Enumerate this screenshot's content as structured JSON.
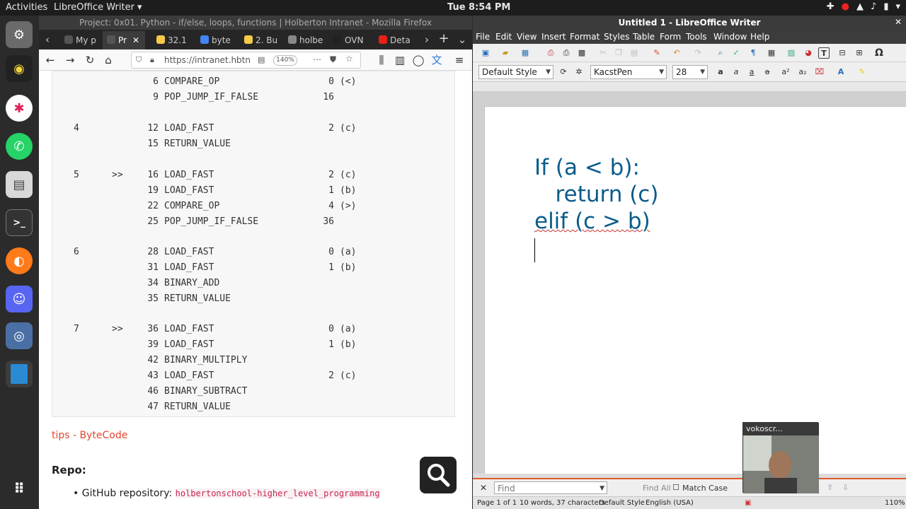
{
  "topbar": {
    "activities": "Activities",
    "app_menu": "LibreOffice Writer ▾",
    "clock": "Tue  8:54 PM",
    "tray": [
      "✚",
      "●",
      "▲",
      "♪",
      "▮",
      "▾"
    ]
  },
  "dock": {
    "items": [
      "settings",
      "radio",
      "slack",
      "whatsapp",
      "files",
      "terminal",
      "firefox",
      "discord",
      "screen-recorder",
      "libreoffice-impress",
      "app-grid"
    ]
  },
  "firefox": {
    "title": "Project: 0x01. Python - if/else, loops, functions | Holberton Intranet - Mozilla Firefox",
    "tabs": [
      {
        "label": "My p",
        "color": "#555"
      },
      {
        "label": "Pr",
        "color": "#555"
      },
      {
        "label": "32.1",
        "color": "#f7c948"
      },
      {
        "label": "byte",
        "color": "#4285f4"
      },
      {
        "label": "2. Bu",
        "color": "#f7c948"
      },
      {
        "label": "holbe",
        "color": "#888"
      },
      {
        "label": "OVN",
        "color": "#222"
      },
      {
        "label": "Deta",
        "color": "#e62117"
      }
    ],
    "url": "https://intranet.hbtn",
    "zoom": "140%",
    "bytecode": [
      {
        "line": "",
        "marker": "",
        "off": "6",
        "op": "COMPARE_OP",
        "arg": "0",
        "note": "(<)"
      },
      {
        "line": "",
        "marker": "",
        "off": "9",
        "op": "POP_JUMP_IF_FALSE",
        "arg": "16",
        "note": ""
      },
      {
        "line": "4",
        "marker": "",
        "off": "12",
        "op": "LOAD_FAST",
        "arg": "2",
        "note": "(c)"
      },
      {
        "line": "",
        "marker": "",
        "off": "15",
        "op": "RETURN_VALUE",
        "arg": "",
        "note": ""
      },
      {
        "line": "5",
        "marker": ">>",
        "off": "16",
        "op": "LOAD_FAST",
        "arg": "2",
        "note": "(c)"
      },
      {
        "line": "",
        "marker": "",
        "off": "19",
        "op": "LOAD_FAST",
        "arg": "1",
        "note": "(b)"
      },
      {
        "line": "",
        "marker": "",
        "off": "22",
        "op": "COMPARE_OP",
        "arg": "4",
        "note": "(>)"
      },
      {
        "line": "",
        "marker": "",
        "off": "25",
        "op": "POP_JUMP_IF_FALSE",
        "arg": "36",
        "note": ""
      },
      {
        "line": "6",
        "marker": "",
        "off": "28",
        "op": "LOAD_FAST",
        "arg": "0",
        "note": "(a)"
      },
      {
        "line": "",
        "marker": "",
        "off": "31",
        "op": "LOAD_FAST",
        "arg": "1",
        "note": "(b)"
      },
      {
        "line": "",
        "marker": "",
        "off": "34",
        "op": "BINARY_ADD",
        "arg": "",
        "note": ""
      },
      {
        "line": "",
        "marker": "",
        "off": "35",
        "op": "RETURN_VALUE",
        "arg": "",
        "note": ""
      },
      {
        "line": "7",
        "marker": ">>",
        "off": "36",
        "op": "LOAD_FAST",
        "arg": "0",
        "note": "(a)"
      },
      {
        "line": "",
        "marker": "",
        "off": "39",
        "op": "LOAD_FAST",
        "arg": "1",
        "note": "(b)"
      },
      {
        "line": "",
        "marker": "",
        "off": "42",
        "op": "BINARY_MULTIPLY",
        "arg": "",
        "note": ""
      },
      {
        "line": "",
        "marker": "",
        "off": "43",
        "op": "LOAD_FAST",
        "arg": "2",
        "note": "(c)"
      },
      {
        "line": "",
        "marker": "",
        "off": "46",
        "op": "BINARY_SUBTRACT",
        "arg": "",
        "note": ""
      },
      {
        "line": "",
        "marker": "",
        "off": "47",
        "op": "RETURN_VALUE",
        "arg": "",
        "note": ""
      }
    ],
    "tips_link": "tips - ByteCode",
    "repo_heading": "Repo:",
    "repo_label": "GitHub repository: ",
    "repo_value": "holbertonschool-higher_level_programming"
  },
  "writer": {
    "title": "Untitled 1 - LibreOffice Writer",
    "menu": [
      "File",
      "Edit",
      "View",
      "Insert",
      "Format",
      "Styles",
      "Table",
      "Form",
      "Tools",
      "Window",
      "Help"
    ],
    "para_style": "Default Style",
    "font_name": "KacstPen",
    "font_size": "28",
    "doc_lines": [
      "If (a < b):",
      "   return (c)",
      "elif (c > b)"
    ],
    "find_placeholder": "Find",
    "find_all": "Find All",
    "match_case": "Match Case",
    "status": {
      "page": "Page 1 of 1",
      "words": "10 words, 37 characters",
      "style": "Default Style",
      "language": "English (USA)",
      "zoom": "110%"
    }
  },
  "webcam": {
    "title": "vokoscr..."
  }
}
